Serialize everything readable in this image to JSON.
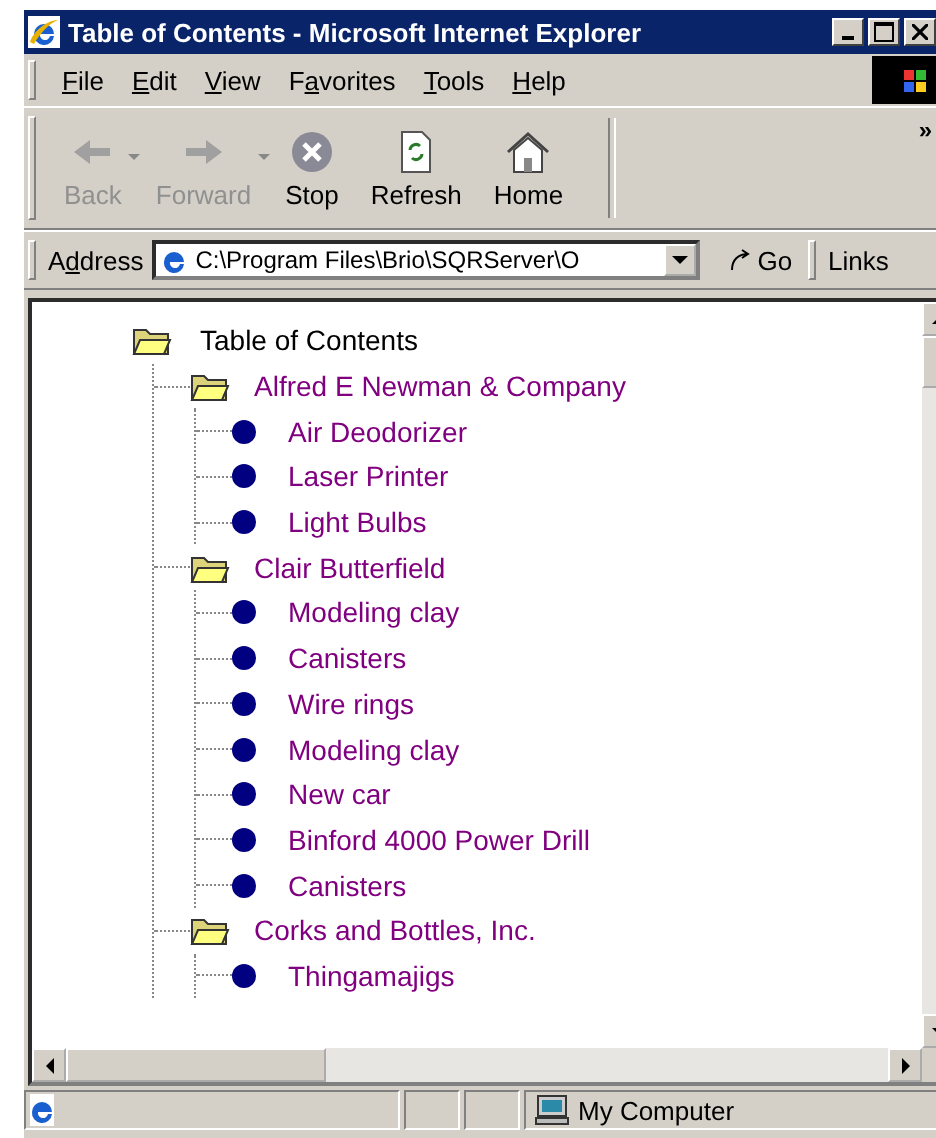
{
  "window": {
    "title": "Table of Contents - Microsoft Internet Explorer"
  },
  "menu": [
    {
      "key": "F",
      "post": "ile"
    },
    {
      "key": "E",
      "post": "dit"
    },
    {
      "key": "V",
      "post": "iew"
    },
    {
      "pre": "F",
      "key": "a",
      "post": "vorites"
    },
    {
      "key": "T",
      "post": "ools"
    },
    {
      "key": "H",
      "post": "elp"
    }
  ],
  "toolbar": {
    "buttons": [
      {
        "kind": "back",
        "label": "Back",
        "disabled": true,
        "dropdown": true
      },
      {
        "kind": "forward",
        "label": "Forward",
        "disabled": true,
        "dropdown": true
      },
      {
        "kind": "stop",
        "label": "Stop",
        "disabled": false,
        "dropdown": false
      },
      {
        "kind": "refresh",
        "label": "Refresh",
        "disabled": false,
        "dropdown": false
      },
      {
        "kind": "home",
        "label": "Home",
        "disabled": false,
        "dropdown": false
      }
    ],
    "more": "»"
  },
  "address_bar": {
    "label": {
      "pre": "A",
      "key": "d",
      "post": "dress"
    },
    "value": "C:\\Program Files\\Brio\\SQRServer\\O",
    "go": "Go",
    "links": "Links"
  },
  "tree": {
    "label": "Table of Contents",
    "kind": "folder",
    "children": [
      {
        "label": "Alfred E Newman & Company",
        "kind": "folder",
        "children": [
          {
            "label": "Air Deodorizer",
            "kind": "item"
          },
          {
            "label": "Laser Printer",
            "kind": "item"
          },
          {
            "label": "Light Bulbs",
            "kind": "item"
          }
        ]
      },
      {
        "label": "Clair Butterfield",
        "kind": "folder",
        "children": [
          {
            "label": "Modeling clay",
            "kind": "item"
          },
          {
            "label": "Canisters",
            "kind": "item"
          },
          {
            "label": "Wire rings",
            "kind": "item"
          },
          {
            "label": "Modeling clay",
            "kind": "item"
          },
          {
            "label": "New car",
            "kind": "item"
          },
          {
            "label": "Binford 4000 Power Drill",
            "kind": "item"
          },
          {
            "label": "Canisters",
            "kind": "item"
          }
        ]
      },
      {
        "label": "Corks and Bottles, Inc.",
        "kind": "folder",
        "children": [
          {
            "label": "Thingamajigs",
            "kind": "item"
          }
        ]
      }
    ]
  },
  "status_bar": {
    "zone": "My Computer"
  }
}
